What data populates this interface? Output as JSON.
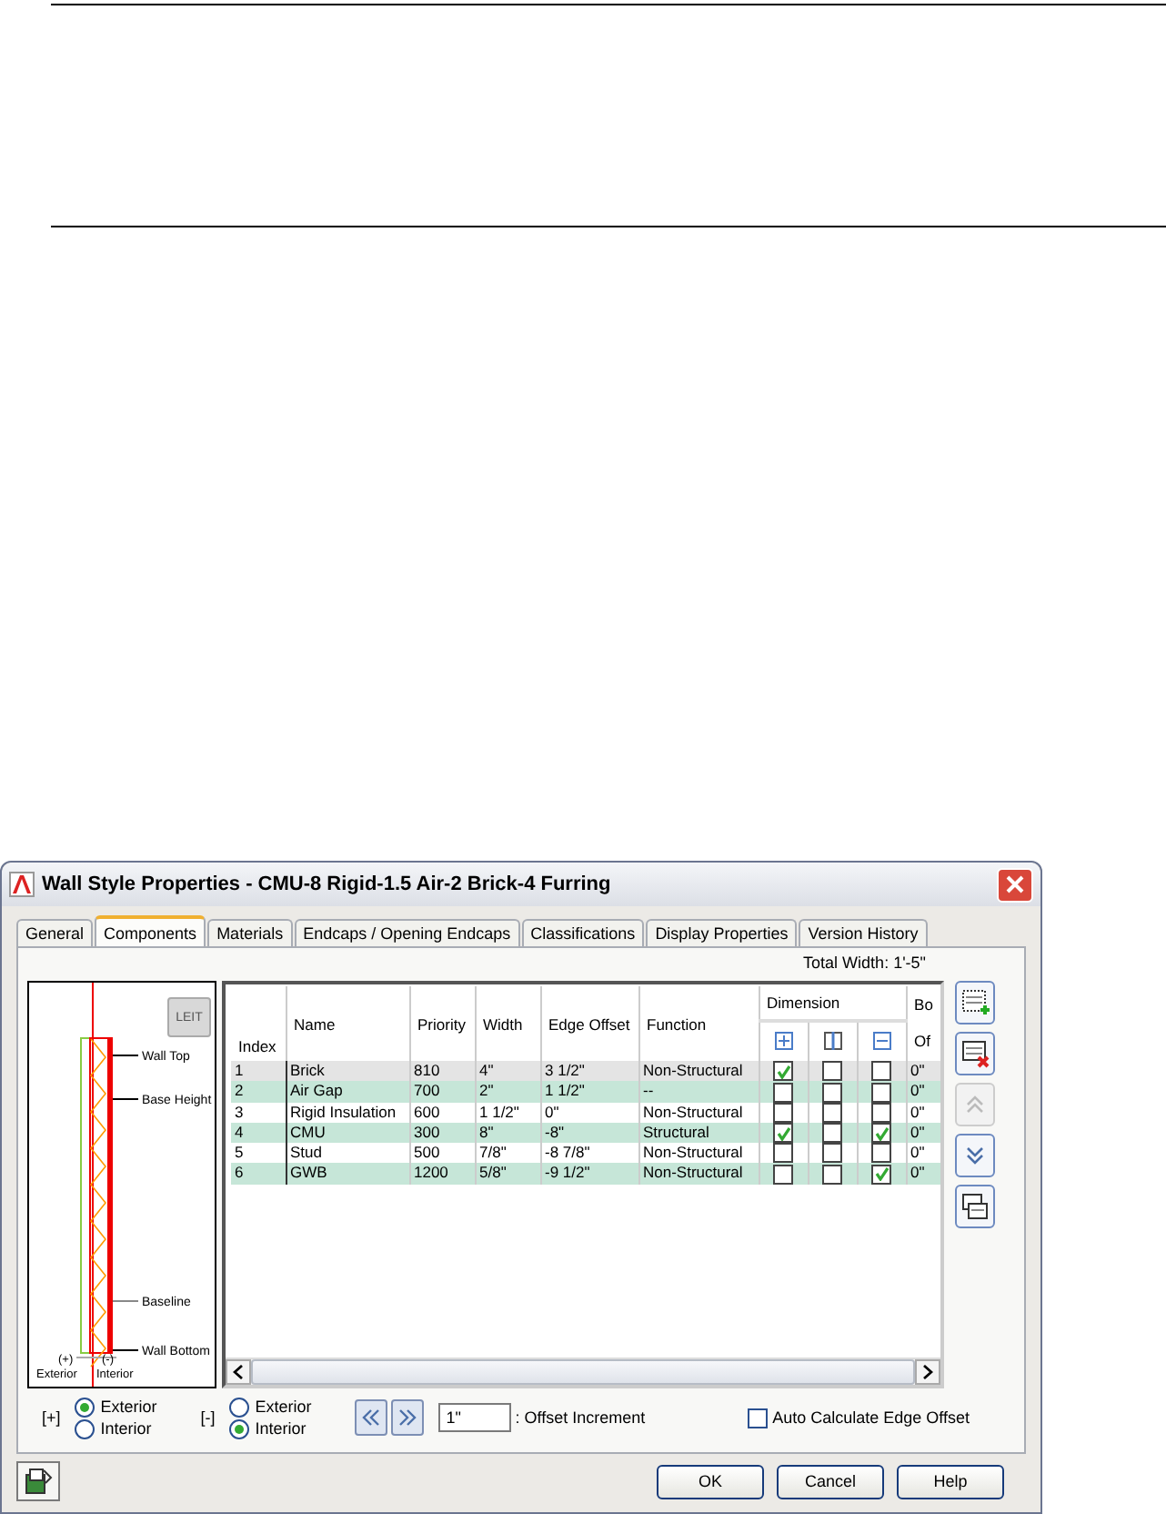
{
  "window": {
    "title": "Wall Style Properties - CMU-8 Rigid-1.5 Air-2 Brick-4 Furring"
  },
  "tabs": [
    {
      "label": "General",
      "selected": false
    },
    {
      "label": "Components",
      "selected": true
    },
    {
      "label": "Materials",
      "selected": false
    },
    {
      "label": "Endcaps / Opening Endcaps",
      "selected": false
    },
    {
      "label": "Classifications",
      "selected": false
    },
    {
      "label": "Display Properties",
      "selected": false
    },
    {
      "label": "Version History",
      "selected": false
    }
  ],
  "total_width": "Total Width: 1'-5\"",
  "preview": {
    "edit_button": {
      "label": "LEIT",
      "disabled": true
    },
    "labels": [
      {
        "kind": "wall-top",
        "text": "Wall Top"
      },
      {
        "kind": "base-height",
        "text": "Base Height"
      },
      {
        "kind": "baseline",
        "text": "Baseline"
      },
      {
        "kind": "wall-bottom",
        "text": "Wall Bottom"
      }
    ],
    "sides": [
      {
        "sign": "(+)",
        "text": "Exterior"
      },
      {
        "sign": "(-)",
        "text": "Interior"
      }
    ]
  },
  "table": {
    "columns": [
      "Index",
      "Name",
      "Priority",
      "Width",
      "Edge Offset",
      "Function"
    ],
    "group_heading": "Dimension",
    "column_cut": "Bo",
    "sub_heading_cut": "Of",
    "rows": [
      {
        "index": "1",
        "name": "Brick",
        "priority": "810",
        "width": "4\"",
        "edge_offset": "3 1/2\"",
        "function": "Non-Structural",
        "dimension": [
          true,
          false,
          false
        ],
        "col_cut": "0\"",
        "selected": true
      },
      {
        "index": "2",
        "name": "Air Gap",
        "priority": "700",
        "width": "2\"",
        "edge_offset": "1 1/2\"",
        "function": "--",
        "dimension": [
          false,
          false,
          false
        ],
        "col_cut": "0\"",
        "selected": false
      },
      {
        "index": "3",
        "name": "Rigid Insulation",
        "priority": "600",
        "width": "1 1/2\"",
        "edge_offset": "0\"",
        "function": "Non-Structural",
        "dimension": [
          false,
          false,
          false
        ],
        "col_cut": "0\"",
        "selected": false
      },
      {
        "index": "4",
        "name": "CMU",
        "priority": "300",
        "width": "8\"",
        "edge_offset": "-8\"",
        "function": "Structural",
        "dimension": [
          true,
          false,
          true
        ],
        "col_cut": "0\"",
        "selected": false
      },
      {
        "index": "5",
        "name": "Stud",
        "priority": "500",
        "width": "7/8\"",
        "edge_offset": "-8 7/8\"",
        "function": "Non-Structural",
        "dimension": [
          false,
          false,
          false
        ],
        "col_cut": "0\"",
        "selected": false
      },
      {
        "index": "6",
        "name": "GWB",
        "priority": "1200",
        "width": "5/8\"",
        "edge_offset": "-9 1/2\"",
        "function": "Non-Structural",
        "dimension": [
          false,
          false,
          true
        ],
        "col_cut": "0\"",
        "selected": false
      }
    ]
  },
  "side_buttons": [
    {
      "kind": "add",
      "disabled": false
    },
    {
      "kind": "remove",
      "disabled": false
    },
    {
      "kind": "up",
      "disabled": true
    },
    {
      "kind": "down",
      "disabled": false
    },
    {
      "kind": "copy",
      "disabled": false
    }
  ],
  "radio_groups": [
    {
      "sign": "[+]",
      "options": [
        {
          "label": "Exterior",
          "selected": true
        },
        {
          "label": "Interior",
          "selected": false
        }
      ]
    },
    {
      "sign": "[-]",
      "options": [
        {
          "label": "Exterior",
          "selected": false
        },
        {
          "label": "Interior",
          "selected": true
        }
      ]
    }
  ],
  "offset_increment": {
    "value": "1\"",
    "label": ": Offset Increment"
  },
  "auto_calculate": {
    "label": "Auto Calculate Edge Offset",
    "checked": false
  },
  "buttons": [
    "OK",
    "Cancel",
    "Help"
  ]
}
